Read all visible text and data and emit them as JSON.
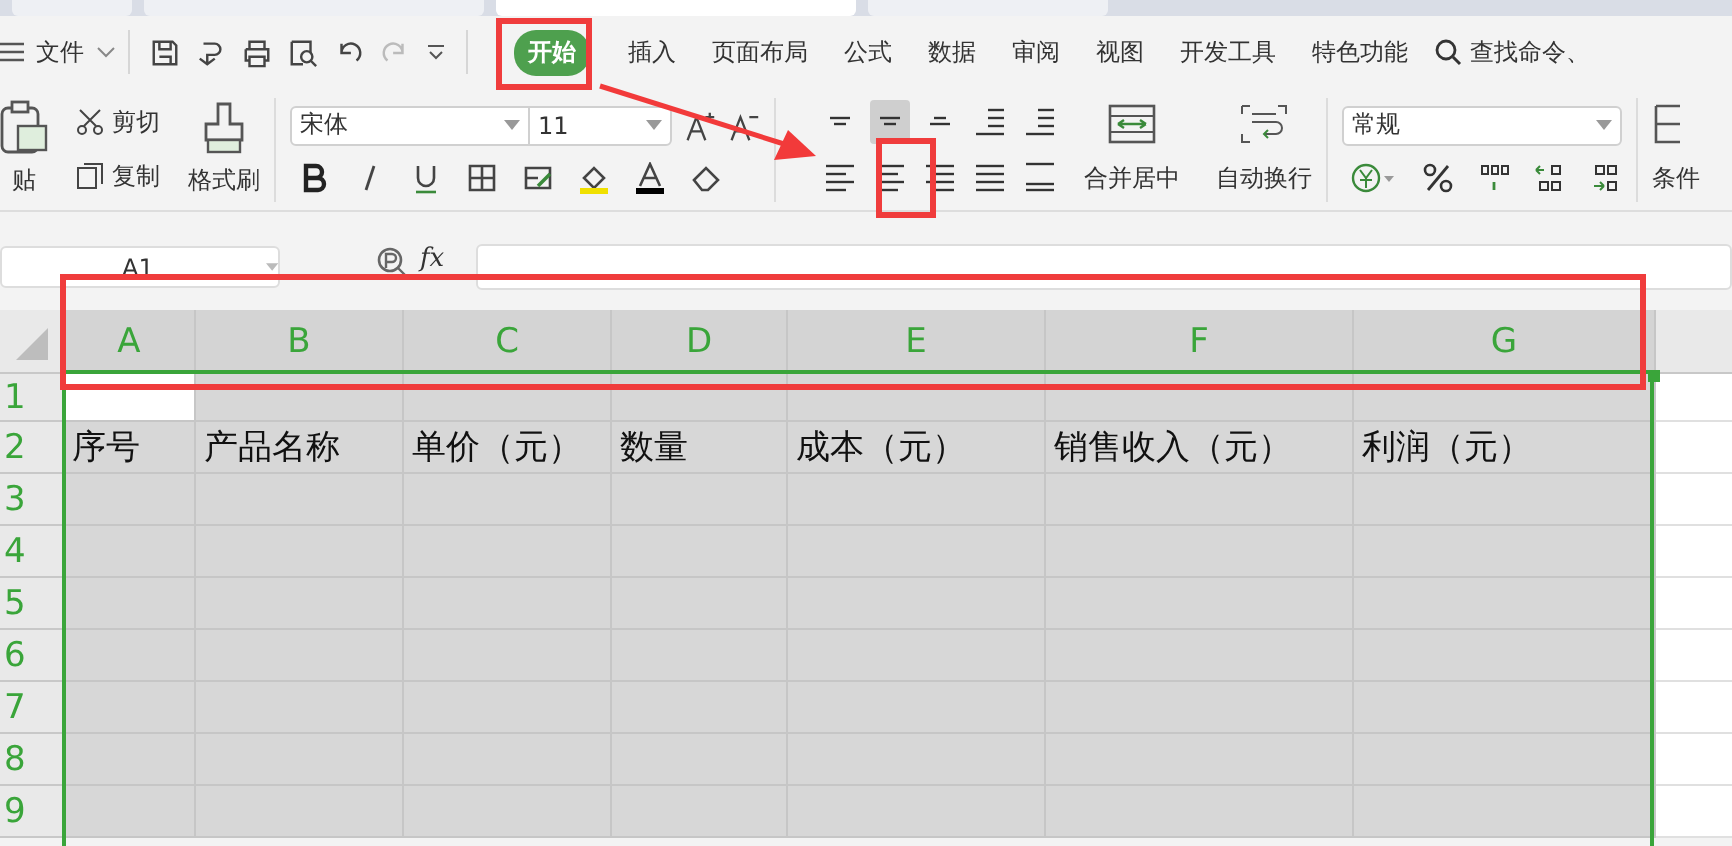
{
  "document_tabs": [
    {
      "selected": false
    },
    {
      "selected": false
    },
    {
      "selected": true
    },
    {
      "selected": false
    }
  ],
  "menu": {
    "file_label": "文件",
    "tabs": [
      {
        "label": "开始",
        "selected": true
      },
      {
        "label": "插入",
        "selected": false
      },
      {
        "label": "页面布局",
        "selected": false
      },
      {
        "label": "公式",
        "selected": false
      },
      {
        "label": "数据",
        "selected": false
      },
      {
        "label": "审阅",
        "selected": false
      },
      {
        "label": "视图",
        "selected": false
      },
      {
        "label": "开发工具",
        "selected": false
      },
      {
        "label": "特色功能",
        "selected": false
      }
    ],
    "search_label": "查找命令、"
  },
  "ribbon": {
    "paste": "贴",
    "cut": "剪切",
    "copy": "复制",
    "format_painter": "格式刷",
    "font_name": "宋体",
    "font_size": "11",
    "align_buttons": [
      {
        "kind": "top",
        "selected": false
      },
      {
        "kind": "middle",
        "selected": true
      },
      {
        "kind": "bottom",
        "selected": false
      },
      {
        "kind": "outdent",
        "selected": false
      },
      {
        "kind": "indent",
        "selected": false
      },
      {
        "kind": "left",
        "selected": false
      },
      {
        "kind": "center",
        "selected": false
      },
      {
        "kind": "right",
        "selected": false
      },
      {
        "kind": "justify",
        "selected": false
      },
      {
        "kind": "distribute",
        "selected": false
      }
    ],
    "merge": "合并居中",
    "wrap": "自动换行",
    "number_format": "常规",
    "conditional": "条件"
  },
  "formula_bar": {
    "name_box": "A1",
    "fx": "fx"
  },
  "sheet": {
    "columns": [
      {
        "label": "A",
        "selected": true
      },
      {
        "label": "B",
        "selected": true
      },
      {
        "label": "C",
        "selected": true
      },
      {
        "label": "D",
        "selected": true
      },
      {
        "label": "E",
        "selected": true
      },
      {
        "label": "F",
        "selected": true
      },
      {
        "label": "G",
        "selected": true
      }
    ],
    "rows": [
      {
        "number": "1",
        "selected": true,
        "cells": []
      },
      {
        "number": "2",
        "selected": true,
        "cells": [
          "序号",
          "产品名称",
          "单价（元）",
          "数量",
          "成本（元）",
          "销售收入（元）",
          "利润（元）"
        ]
      },
      {
        "number": "3",
        "selected": true,
        "cells": []
      },
      {
        "number": "4",
        "selected": true,
        "cells": []
      },
      {
        "number": "5",
        "selected": true,
        "cells": []
      },
      {
        "number": "6",
        "selected": true,
        "cells": []
      },
      {
        "number": "7",
        "selected": true,
        "cells": []
      },
      {
        "number": "8",
        "selected": true,
        "cells": []
      },
      {
        "number": "9",
        "selected": true,
        "cells": []
      }
    ]
  }
}
